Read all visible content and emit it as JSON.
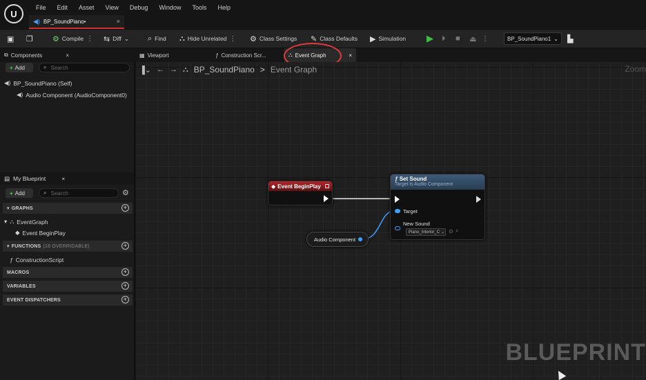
{
  "app": {
    "logo": "U"
  },
  "menu": [
    "File",
    "Edit",
    "Asset",
    "View",
    "Debug",
    "Window",
    "Tools",
    "Help"
  ],
  "doc_tab": {
    "label": "BP_SoundPiano•",
    "close": "×"
  },
  "toolbar": {
    "compile": "Compile",
    "diff": "Diff",
    "find": "Find",
    "hide_unrelated": "Hide Unrelated",
    "class_settings": "Class Settings",
    "class_defaults": "Class Defaults",
    "simulation": "Simulation",
    "debug_object": "BP_SoundPiano1"
  },
  "panel_tabs": {
    "components": "Components",
    "viewport": "Viewport",
    "construction": "Construction Scr...",
    "event_graph": "Event Graph",
    "close": "×"
  },
  "components": {
    "add": "Add",
    "search_placeholder": "Search",
    "items": [
      "BP_SoundPiano (Self)",
      "Audio Component (AudioComponent0)"
    ]
  },
  "my_blueprint": {
    "title": "My Blueprint",
    "add": "Add",
    "search_placeholder": "Search",
    "sections": {
      "graphs": "GRAPHS",
      "functions": "FUNCTIONS",
      "functions_sub": "(18 OVERRIDABLE)",
      "macros": "MACROS",
      "variables": "VARIABLES",
      "dispatchers": "EVENT DISPATCHERS"
    },
    "graph_items": [
      "EventGraph",
      "Event BeginPlay"
    ],
    "function_items": [
      "ConstructionScript"
    ]
  },
  "graph": {
    "breadcrumb_root": "BP_SoundPiano",
    "breadcrumb_sep": ">",
    "breadcrumb_leaf": "Event Graph",
    "zoom": "Zoom",
    "watermark": "BLUEPRINT",
    "nodes": {
      "event_begin_play": "Event BeginPlay",
      "set_sound_title": "Set Sound",
      "set_sound_sub": "Target is Audio Component",
      "target_pin": "Target",
      "new_sound_pin": "New Sound",
      "new_sound_value": "Piano_Interior_C",
      "audio_component": "Audio Component"
    }
  },
  "colors": {
    "accent_red": "#d62f2f",
    "pin_blue": "#3ea0ff",
    "play_green": "#40c040"
  }
}
